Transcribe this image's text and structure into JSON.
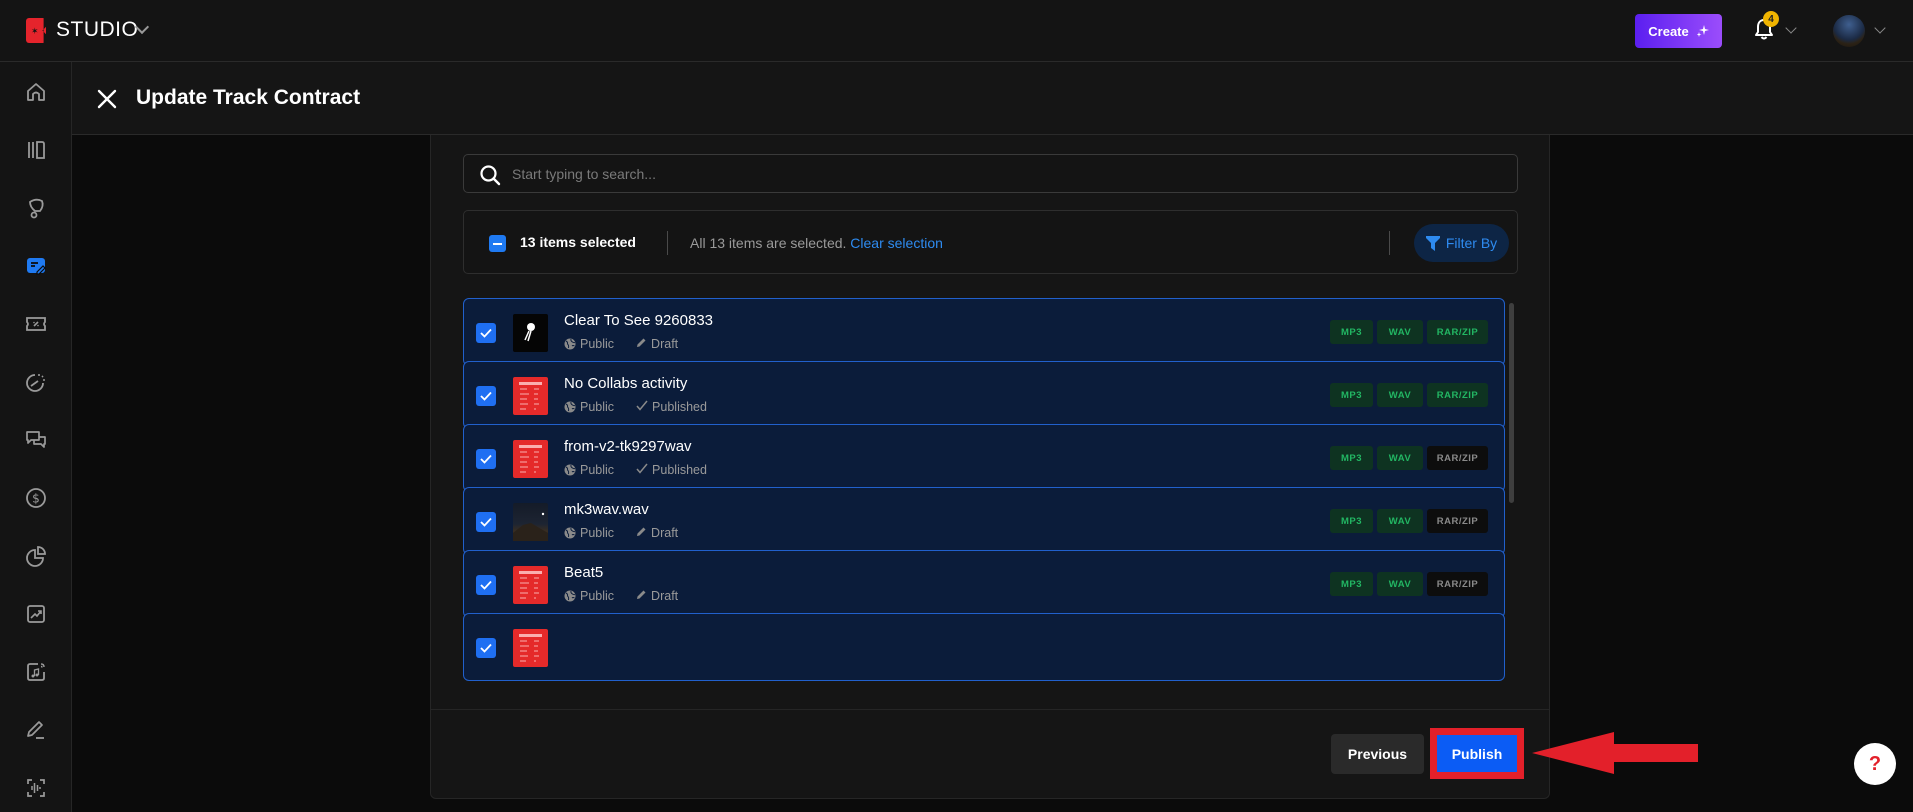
{
  "topbar": {
    "brand": "STUDIO",
    "create_label": "Create",
    "notification_count": "4"
  },
  "sidebar": {
    "items": [
      {
        "name": "home",
        "active": false
      },
      {
        "name": "library",
        "active": false
      },
      {
        "name": "marketing",
        "active": false
      },
      {
        "name": "contracts",
        "active": true
      },
      {
        "name": "coupons",
        "active": false
      },
      {
        "name": "analytics",
        "active": false
      },
      {
        "name": "messages",
        "active": false
      },
      {
        "name": "sales",
        "active": false
      },
      {
        "name": "reports",
        "active": false
      },
      {
        "name": "growth",
        "active": false
      },
      {
        "name": "music-distribution",
        "active": false
      },
      {
        "name": "edit",
        "active": false
      },
      {
        "name": "audio-scan",
        "active": false
      }
    ]
  },
  "header": {
    "title": "Update Track Contract"
  },
  "search": {
    "placeholder": "Start typing to search...",
    "value": ""
  },
  "selection": {
    "count_label": "13 items selected",
    "all_selected_text": "All 13 items are selected.",
    "clear_label": "Clear selection",
    "filter_label": "Filter By"
  },
  "colors": {
    "accent": "#1f6ff2",
    "link": "#2e8bf0",
    "row_border": "#2160cc",
    "row_bg": "#0b1c3a",
    "tag_on_text": "#22b663",
    "annotation_red": "#e3202a"
  },
  "tracks": [
    {
      "title": "Clear To See 9260833",
      "visibility": "Public",
      "status": "Draft",
      "status_icon": "pencil-icon",
      "thumb": "black",
      "checked": true,
      "formats": [
        {
          "label": "MP3",
          "available": true
        },
        {
          "label": "WAV",
          "available": true
        },
        {
          "label": "RAR/ZIP",
          "available": true
        }
      ]
    },
    {
      "title": "No Collabs activity",
      "visibility": "Public",
      "status": "Published",
      "status_icon": "check-icon",
      "thumb": "red",
      "checked": true,
      "formats": [
        {
          "label": "MP3",
          "available": true
        },
        {
          "label": "WAV",
          "available": true
        },
        {
          "label": "RAR/ZIP",
          "available": true
        }
      ]
    },
    {
      "title": "from-v2-tk9297wav",
      "visibility": "Public",
      "status": "Published",
      "status_icon": "check-icon",
      "thumb": "red",
      "checked": true,
      "formats": [
        {
          "label": "MP3",
          "available": true
        },
        {
          "label": "WAV",
          "available": true
        },
        {
          "label": "RAR/ZIP",
          "available": false
        }
      ]
    },
    {
      "title": "mk3wav.wav",
      "visibility": "Public",
      "status": "Draft",
      "status_icon": "pencil-icon",
      "thumb": "night",
      "checked": true,
      "formats": [
        {
          "label": "MP3",
          "available": true
        },
        {
          "label": "WAV",
          "available": true
        },
        {
          "label": "RAR/ZIP",
          "available": false
        }
      ]
    },
    {
      "title": "Beat5",
      "visibility": "Public",
      "status": "Draft",
      "status_icon": "pencil-icon",
      "thumb": "red",
      "checked": true,
      "formats": [
        {
          "label": "MP3",
          "available": true
        },
        {
          "label": "WAV",
          "available": true
        },
        {
          "label": "RAR/ZIP",
          "available": false
        }
      ]
    },
    {
      "title": "",
      "visibility": "",
      "status": "",
      "status_icon": "",
      "thumb": "red",
      "checked": true,
      "formats": []
    }
  ],
  "footer": {
    "previous_label": "Previous",
    "publish_label": "Publish"
  },
  "help": {
    "label": "?"
  }
}
